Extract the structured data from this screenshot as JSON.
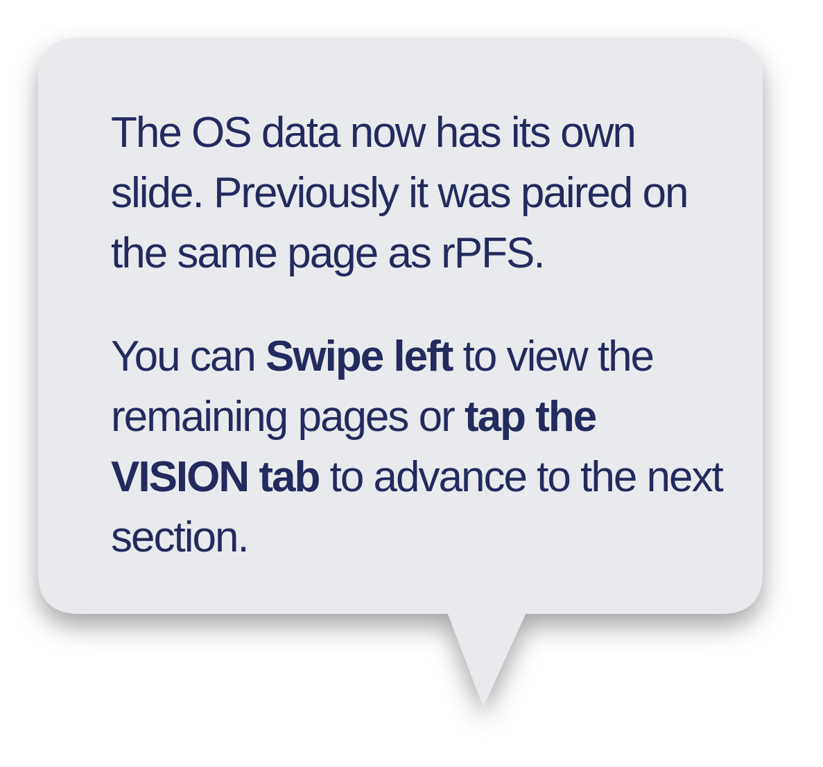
{
  "bubble": {
    "fill_color": "#e9eaed",
    "text_color": "#232a5e",
    "paragraph_1": "The OS data now has its own slide. Previously it was paired on the same page as rPFS.",
    "paragraph_2": {
      "seg_1": "You can ",
      "seg_2_bold": "Swipe left",
      "seg_3": " to view the remaining pages or ",
      "seg_4_bold": "tap the VISION tab",
      "seg_5": " to advance to the next section."
    }
  }
}
